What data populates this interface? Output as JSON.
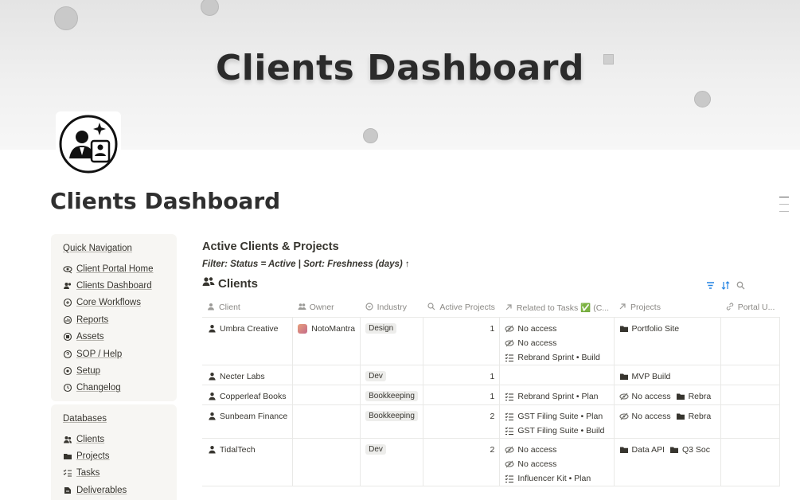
{
  "cover": {
    "title": "Clients Dashboard"
  },
  "page": {
    "title": "Clients Dashboard"
  },
  "quick_nav": {
    "title": "Quick Navigation",
    "items": [
      {
        "label": "Client Portal Home",
        "icon": "eye-link-icon"
      },
      {
        "label": "Clients Dashboard",
        "icon": "users-link-icon"
      },
      {
        "label": "Core Workflows",
        "icon": "workflow-link-icon"
      },
      {
        "label": "Reports",
        "icon": "reports-link-icon"
      },
      {
        "label": "Assets",
        "icon": "assets-link-icon"
      },
      {
        "label": "SOP / Help",
        "icon": "help-link-icon"
      },
      {
        "label": "Setup",
        "icon": "setup-link-icon"
      },
      {
        "label": "Changelog",
        "icon": "changelog-link-icon"
      }
    ]
  },
  "databases": {
    "title": "Databases",
    "items": [
      {
        "label": "Clients",
        "icon": "clients-db-icon"
      },
      {
        "label": "Projects",
        "icon": "projects-db-icon"
      },
      {
        "label": "Tasks",
        "icon": "tasks-db-icon"
      },
      {
        "label": "Deliverables",
        "icon": "deliverables-db-icon"
      }
    ]
  },
  "view": {
    "title": "Active Clients & Projects",
    "filter": "Filter: Status = Active | Sort: Freshness (days) ↑",
    "db_title": "Clients"
  },
  "table": {
    "columns": [
      "Client",
      "Owner",
      "Industry",
      "Active Projects",
      "Related to Tasks ✅ (C...",
      "Projects",
      "Portal U..."
    ],
    "rows": [
      {
        "client": "Umbra Creative",
        "owner": "NotoMantra",
        "industry": "Design",
        "active_projects": "1",
        "tasks": [
          "No access",
          "No access",
          "Rebrand Sprint • Build"
        ],
        "task_icons": [
          "eye-off-icon",
          "eye-off-icon",
          "checklist-icon"
        ],
        "projects": [
          "Portfolio Site"
        ]
      },
      {
        "client": "Necter Labs",
        "owner": "",
        "industry": "Dev",
        "active_projects": "1",
        "tasks": [],
        "task_icons": [],
        "projects": [
          "MVP Build"
        ]
      },
      {
        "client": "Copperleaf Books",
        "owner": "",
        "industry": "Bookkeeping",
        "active_projects": "1",
        "tasks": [
          "Rebrand Sprint • Plan"
        ],
        "task_icons": [
          "checklist-icon"
        ],
        "projects": [
          "No access",
          "Rebra"
        ]
      },
      {
        "client": "Sunbeam Finance",
        "owner": "",
        "industry": "Bookkeeping",
        "active_projects": "2",
        "tasks": [
          "GST Filing Suite • Plan",
          "GST Filing Suite • Build"
        ],
        "task_icons": [
          "checklist-icon",
          "checklist-icon"
        ],
        "projects": [
          "No access",
          "Rebra"
        ]
      },
      {
        "client": "TidalTech",
        "owner": "",
        "industry": "Dev",
        "active_projects": "2",
        "tasks": [
          "No access",
          "No access",
          "Influencer Kit • Plan"
        ],
        "task_icons": [
          "eye-off-icon",
          "eye-off-icon",
          "checklist-icon"
        ],
        "projects": [
          "Data API",
          "Q3 Soc"
        ]
      }
    ]
  }
}
